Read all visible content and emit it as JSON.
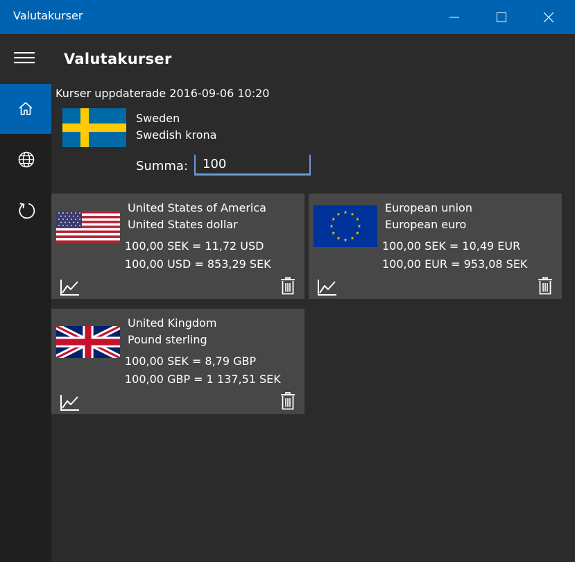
{
  "window": {
    "title": "Valutakurser"
  },
  "app": {
    "title": "Valutakurser"
  },
  "nav": {
    "items": [
      {
        "icon": "home-icon",
        "active": true
      },
      {
        "icon": "globe-icon",
        "active": false
      },
      {
        "icon": "refresh-icon",
        "active": false
      }
    ]
  },
  "updated_text": "Kurser uppdaterade 2016-09-06 10:20",
  "base": {
    "country": "Sweden",
    "currency": "Swedish krona",
    "summa_label": "Summa:",
    "summa_value": "100"
  },
  "cards": [
    {
      "country": "United States of America",
      "currency": "United States dollar",
      "rate1": "100,00 SEK = 11,72 USD",
      "rate2": "100,00 USD = 853,29 SEK"
    },
    {
      "country": "European union",
      "currency": "European euro",
      "rate1": "100,00 SEK = 10,49 EUR",
      "rate2": "100,00 EUR = 953,08 SEK"
    },
    {
      "country": "United Kingdom",
      "currency": "Pound sterling",
      "rate1": "100,00 SEK = 8,79 GBP",
      "rate2": "100,00 GBP = 1 137,51 SEK"
    }
  ],
  "colors": {
    "accent": "#0063b1",
    "background": "#2b2b2b",
    "nav_background": "#1f1f1f",
    "card_background": "#474747",
    "input_underline": "#6a9bd8"
  }
}
